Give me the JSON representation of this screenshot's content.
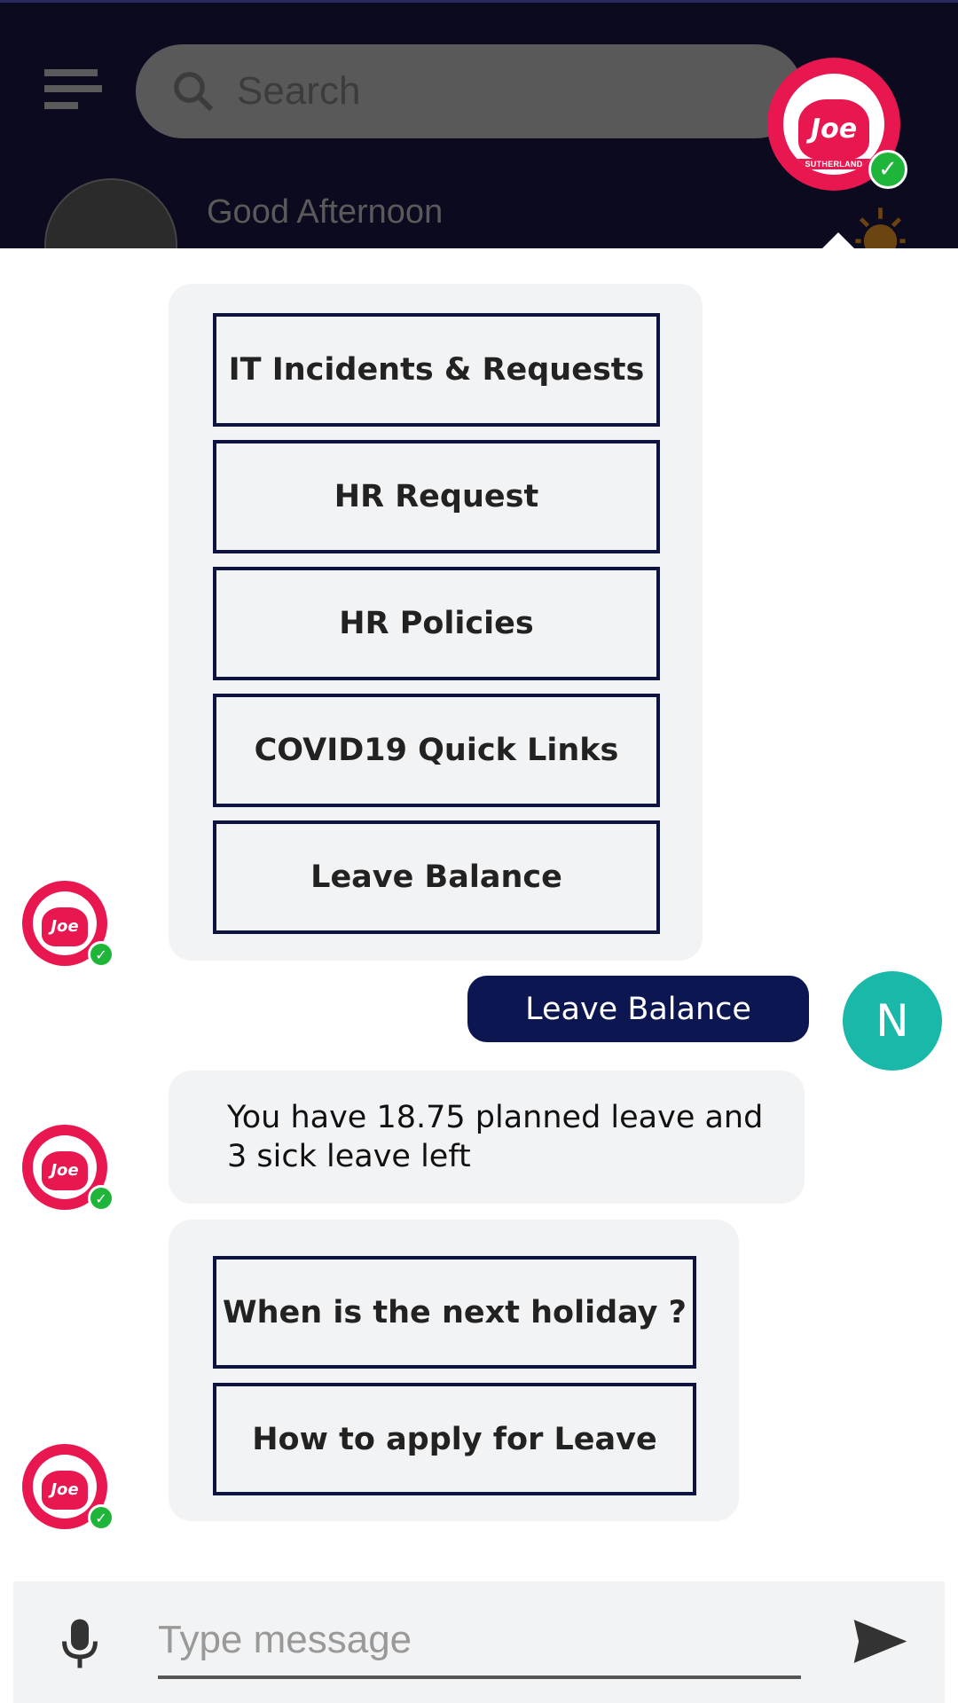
{
  "header": {
    "search_placeholder": "Search",
    "greeting": "Good Afternoon",
    "agent_logo_text": "Joe",
    "agent_logo_brand": "SUTHERLAND"
  },
  "chat": {
    "menu_options": [
      "IT Incidents & Requests",
      "HR Request",
      "HR Policies",
      "COVID19 Quick Links",
      "Leave Balance"
    ],
    "user_message": "Leave Balance",
    "user_initial": "N",
    "bot_reply": "You have 18.75 planned leave and 3 sick leave left",
    "followup_options": [
      "When is the next holiday ?",
      "How to apply for Leave"
    ]
  },
  "input": {
    "placeholder": "Type message"
  },
  "colors": {
    "header_bg": "#0b0a1e",
    "user_bubble": "#0c1650",
    "user_avatar": "#19b8a8",
    "agent_brand": "#e8174f",
    "online": "#1fb53a",
    "button_border": "#0e1340"
  }
}
